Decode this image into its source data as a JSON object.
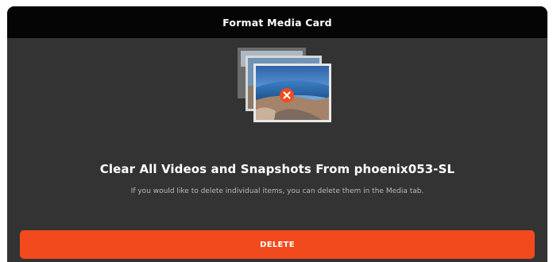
{
  "dialog": {
    "title": "Format Media Card",
    "heading": "Clear All Videos and Snapshots From phoenix053-SL",
    "subtext": "If you would like to delete individual items, you can delete them in the Media tab.",
    "delete_label": "DELETE"
  },
  "illustration": {
    "icon": "delete-x-icon",
    "badge_color": "#f24a1c"
  },
  "colors": {
    "titlebar_bg": "#050505",
    "dialog_bg": "#333333",
    "accent": "#f24a1c"
  }
}
